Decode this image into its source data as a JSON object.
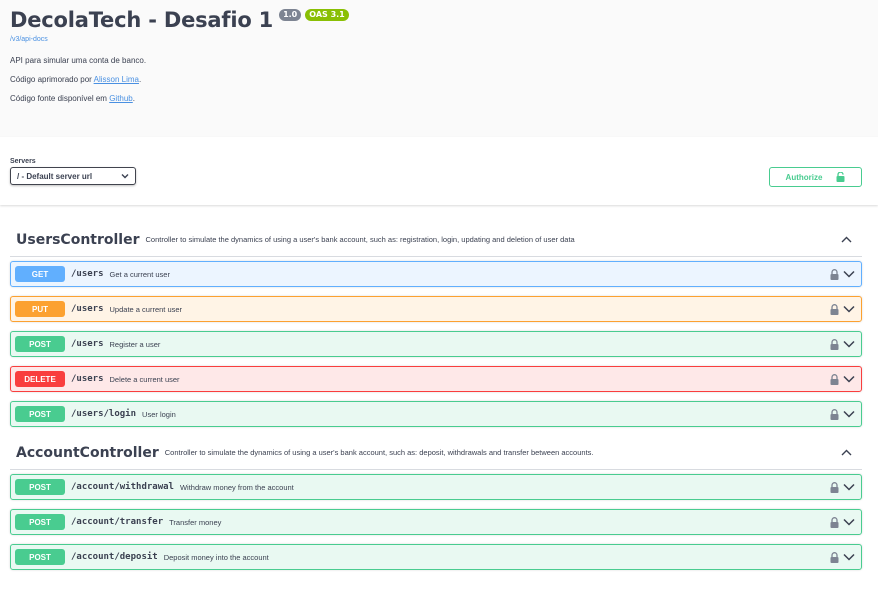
{
  "info": {
    "title": "DecolaTech - Desafio 1",
    "version": "1.0",
    "oas": "OAS 3.1",
    "api_docs_link": "/v3/api-docs",
    "description_line1": "API para simular uma conta de banco.",
    "description_line2_prefix": "Código aprimorado por",
    "description_line2_link": "Alisson Lima",
    "description_line2_suffix": ".",
    "description_line3_prefix": "Código fonte disponível em",
    "description_line3_link": "Github",
    "description_line3_suffix": "."
  },
  "servers": {
    "label": "Servers",
    "selected": "/ - Default server url"
  },
  "authorize": {
    "label": "Authorize"
  },
  "tags": [
    {
      "name": "UsersController",
      "description": "Controller to simulate the dynamics of using a user's bank account, such as: registration, login, updating and deletion of user data",
      "operations": [
        {
          "method": "GET",
          "path": "/users",
          "summary": "Get a current user"
        },
        {
          "method": "PUT",
          "path": "/users",
          "summary": "Update a current user"
        },
        {
          "method": "POST",
          "path": "/users",
          "summary": "Register a user"
        },
        {
          "method": "DELETE",
          "path": "/users",
          "summary": "Delete a current user"
        },
        {
          "method": "POST",
          "path": "/users/login",
          "summary": "User login"
        }
      ]
    },
    {
      "name": "AccountController",
      "description": "Controller to simulate the dynamics of using a user's bank account, such as: deposit, withdrawals and transfer between accounts.",
      "operations": [
        {
          "method": "POST",
          "path": "/account/withdrawal",
          "summary": "Withdraw money from the account"
        },
        {
          "method": "POST",
          "path": "/account/transfer",
          "summary": "Transfer money"
        },
        {
          "method": "POST",
          "path": "/account/deposit",
          "summary": "Deposit money into the account"
        }
      ]
    }
  ],
  "colors": {
    "get": "#61affe",
    "put": "#fca130",
    "post": "#49cc90",
    "delete": "#f93e3e",
    "link": "#4990e2"
  },
  "icons": {
    "lock": "lock-icon",
    "chevron_down": "chevron-down-icon",
    "chevron_up": "chevron-up-icon",
    "authorize_lock": "unlocked-icon",
    "select_arrow": "chevron-down-icon"
  }
}
